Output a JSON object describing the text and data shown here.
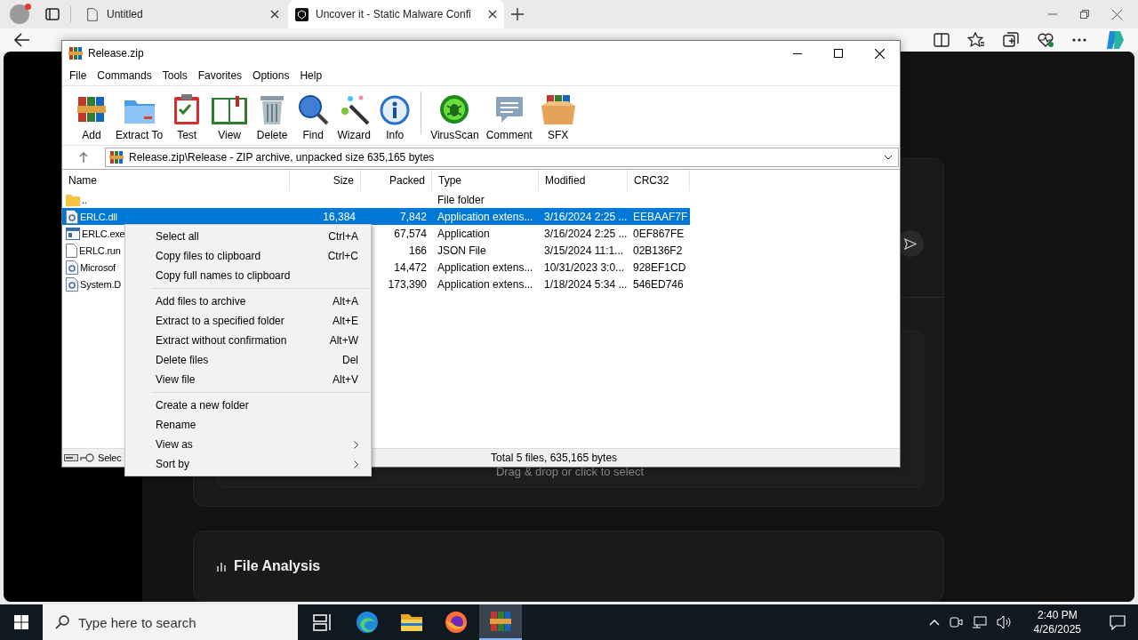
{
  "browser": {
    "tabs": [
      {
        "title": "Untitled",
        "selected": false
      },
      {
        "title": "Uncover it - Static Malware Confi",
        "selected": true
      }
    ],
    "page": {
      "drop_hint": "Drag & drop or click to select",
      "section_title": "File Analysis"
    }
  },
  "window": {
    "title": "Release.zip",
    "menu": [
      "File",
      "Commands",
      "Tools",
      "Favorites",
      "Options",
      "Help"
    ],
    "toolbar": [
      {
        "label": "Add",
        "kind": "add"
      },
      {
        "label": "Extract To",
        "kind": "extract"
      },
      {
        "label": "Test",
        "kind": "test"
      },
      {
        "label": "View",
        "kind": "view"
      },
      {
        "label": "Delete",
        "kind": "delete"
      },
      {
        "label": "Find",
        "kind": "find"
      },
      {
        "label": "Wizard",
        "kind": "wizard"
      },
      {
        "label": "Info",
        "kind": "info"
      },
      {
        "label": "VirusScan",
        "kind": "virusscan"
      },
      {
        "label": "Comment",
        "kind": "comment"
      },
      {
        "label": "SFX",
        "kind": "sfx"
      }
    ],
    "address": "Release.zip\\Release - ZIP archive, unpacked size 635,165 bytes",
    "columns": [
      "Name",
      "Size",
      "Packed",
      "Type",
      "Modified",
      "CRC32"
    ],
    "rows": [
      {
        "name": "..",
        "type": "File folder",
        "kind": "folder",
        "selected": false
      },
      {
        "name": "ERLC.dll",
        "size": "16,384",
        "packed": "7,842",
        "type": "Application extens...",
        "modified": "3/16/2024 2:25 ...",
        "crc": "EEBAAF7F",
        "kind": "dll",
        "selected": true
      },
      {
        "name": "ERLC.exe",
        "packed": "67,574",
        "type": "Application",
        "modified": "3/16/2024 2:25 ...",
        "crc": "0EF867FE",
        "kind": "exe",
        "selected": false
      },
      {
        "name": "ERLC.run",
        "packed": "166",
        "type": "JSON File",
        "modified": "3/15/2024 11:1...",
        "crc": "02B136F2",
        "kind": "file",
        "selected": false
      },
      {
        "name": "Microsof",
        "packed": "14,472",
        "type": "Application extens...",
        "modified": "10/31/2023 3:0...",
        "crc": "928EF1CD",
        "kind": "dll",
        "selected": false
      },
      {
        "name": "System.D",
        "packed": "173,390",
        "type": "Application extens...",
        "modified": "1/18/2024 5:34 ...",
        "crc": "546ED746",
        "kind": "dll",
        "selected": false
      }
    ],
    "status_left": "Selec",
    "status": "Total 5 files, 635,165 bytes"
  },
  "context_menu": {
    "sections": [
      {
        "items": [
          {
            "label": "Select all",
            "shortcut": "Ctrl+A",
            "submenu": false
          },
          {
            "label": "Copy files to clipboard",
            "shortcut": "Ctrl+C",
            "submenu": false
          },
          {
            "label": "Copy full names to clipboard",
            "submenu": false
          }
        ]
      },
      {
        "items": [
          {
            "label": "Add files to archive",
            "shortcut": "Alt+A",
            "submenu": false
          },
          {
            "label": "Extract to a specified folder",
            "shortcut": "Alt+E",
            "submenu": false
          },
          {
            "label": "Extract without confirmation",
            "shortcut": "Alt+W",
            "submenu": false
          },
          {
            "label": "Delete files",
            "shortcut": "Del",
            "submenu": false
          },
          {
            "label": "View file",
            "shortcut": "Alt+V",
            "submenu": false
          }
        ]
      },
      {
        "items": [
          {
            "label": "Create a new folder",
            "submenu": false
          },
          {
            "label": "Rename",
            "submenu": false
          },
          {
            "label": "View as",
            "submenu": true
          },
          {
            "label": "Sort by",
            "submenu": true
          }
        ]
      }
    ]
  },
  "taskbar": {
    "search_placeholder": "Type here to search",
    "apps": [
      {
        "kind": "taskview",
        "selected": false
      },
      {
        "kind": "edge",
        "selected": false
      },
      {
        "kind": "explorer",
        "selected": false
      },
      {
        "kind": "firefox",
        "selected": false
      },
      {
        "kind": "winrar",
        "selected": true
      }
    ],
    "time": "2:40 PM",
    "date": "4/26/2025"
  }
}
